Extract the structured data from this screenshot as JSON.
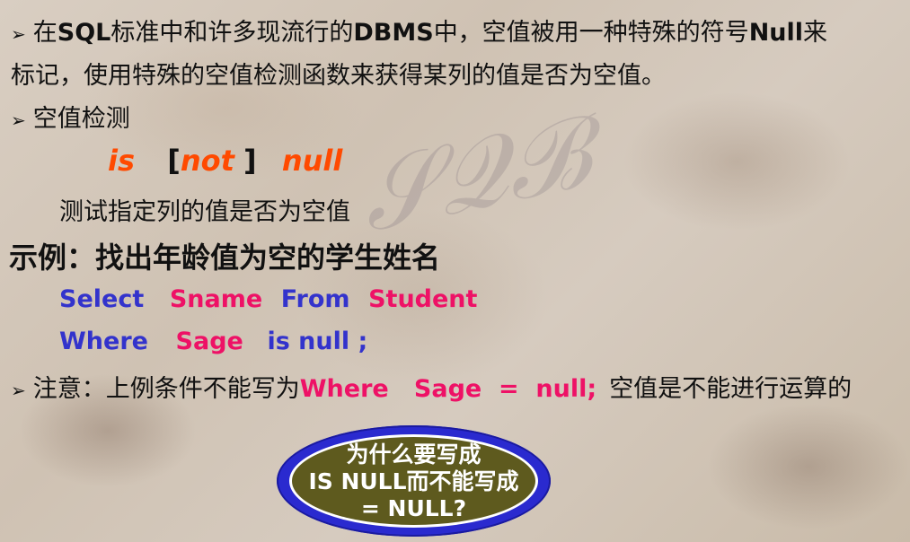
{
  "intro": {
    "bullet": "➢",
    "line1_parts": [
      "在",
      "SQL",
      "标准中和许多现流行的",
      "DBMS",
      "中，空值被用一种特殊的符号",
      "Null",
      "来"
    ],
    "line2": "标记，使用特殊的空值检测函数来获得某列的值是否为空值。"
  },
  "null_check": {
    "bullet": "➢",
    "heading": "空值检测",
    "syntax_is": "is",
    "syntax_open": "[",
    "syntax_not": "not",
    "syntax_close": "]",
    "syntax_null": "null",
    "description": "测试指定列的值是否为空值"
  },
  "example": {
    "title": "示例：找出年龄值为空的学生姓名",
    "sql_line1": {
      "select": "Select",
      "col": "Sname",
      "from": "From",
      "table": "Student"
    },
    "sql_line2": {
      "where": "Where",
      "col": "Sage",
      "op": "is null ;"
    }
  },
  "note": {
    "bullet": "➢",
    "label": "注意：上例条件不能写为",
    "code": "Where   Sage  =  null;",
    "tail": "空值是不能进行运算的"
  },
  "callout": {
    "line1": "为什么要写成",
    "line2": "IS NULL而不能写成",
    "line3": "= NULL?"
  },
  "colors": {
    "keyword_orange": "#ff4a00",
    "sql_blue": "#3333cc",
    "sql_pink": "#ee1166",
    "oval_border": "#2a2acf",
    "oval_fill": "#5e5a1e"
  }
}
